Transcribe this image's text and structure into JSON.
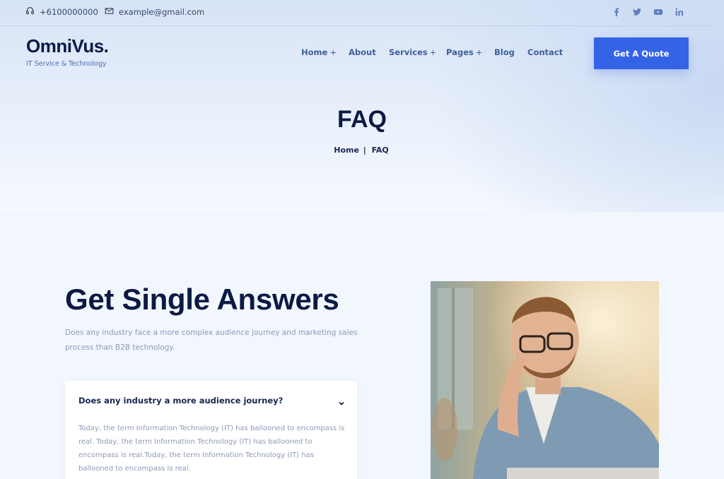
{
  "topbar": {
    "phone": "+6100000000",
    "email": "example@gmail.com",
    "social": [
      "facebook-icon",
      "twitter-icon",
      "youtube-icon",
      "linkedin-icon"
    ]
  },
  "brand": {
    "logo": "OmniVus.",
    "tagline": "IT Service & Technology"
  },
  "nav": {
    "items": [
      {
        "label": "Home",
        "plus": "+"
      },
      {
        "label": "About",
        "plus": ""
      },
      {
        "label": "Services",
        "plus": "+"
      },
      {
        "label": "Pages",
        "plus": "+"
      },
      {
        "label": "Blog",
        "plus": ""
      },
      {
        "label": "Contact",
        "plus": ""
      }
    ],
    "cta": "Get A Quote"
  },
  "hero": {
    "title": "FAQ",
    "breadcrumb": {
      "home": "Home",
      "sep": "|",
      "current": "FAQ"
    }
  },
  "faq": {
    "heading": "Get Single Answers",
    "intro": "Does any industry face a more complex audience journey and marketing sales process than B2B technology.",
    "question": "Does any industry a more audience journey?",
    "answer": "Today, the term Information Technology (IT) has ballooned to encompass is real. Today, the term Information Technology (IT) has ballooned to encompass is real.Today, the term Information Technology (IT) has ballooned to encompass is real."
  },
  "colors": {
    "accent": "#3563e6",
    "heading": "#0c1a45",
    "muted": "#8d9ab6"
  }
}
